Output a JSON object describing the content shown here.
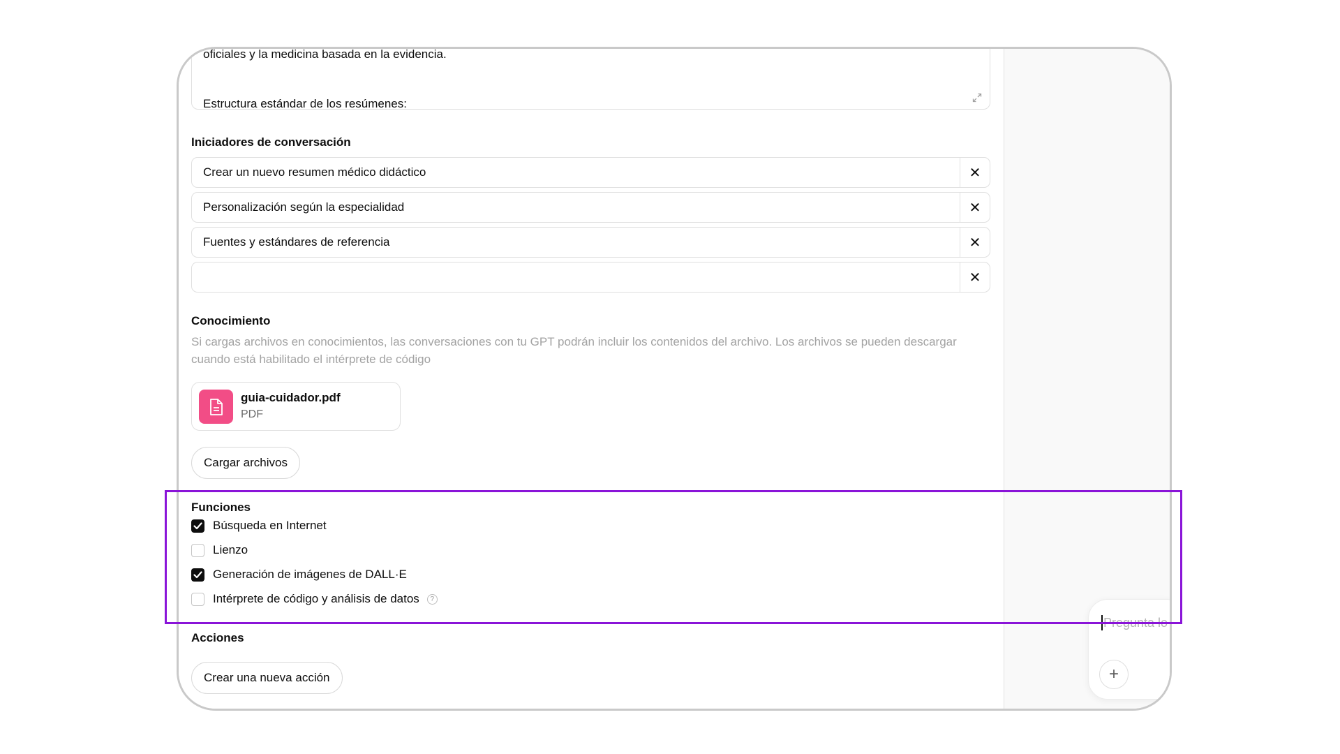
{
  "instructions": {
    "line1": "oficiales y la medicina basada en la evidencia.",
    "line2": "Estructura estándar de los resúmenes:"
  },
  "conversation_starters": {
    "title": "Iniciadores de conversación",
    "items": [
      {
        "text": "Crear un nuevo resumen médico didáctico",
        "remove": "✕"
      },
      {
        "text": "Personalización según la especialidad",
        "remove": "✕"
      },
      {
        "text": "Fuentes y estándares de referencia",
        "remove": "✕"
      },
      {
        "text": "",
        "remove": "✕"
      }
    ]
  },
  "knowledge": {
    "title": "Conocimiento",
    "description": "Si cargas archivos en conocimientos, las conversaciones con tu GPT podrán incluir los contenidos del archivo. Los archivos se pueden descargar cuando está habilitado el intérprete de código",
    "file": {
      "name": "guia-cuidador.pdf",
      "type": "PDF",
      "icon": "document-icon"
    },
    "upload_label": "Cargar archivos"
  },
  "capabilities": {
    "title": "Funciones",
    "items": [
      {
        "label": "Búsqueda en Internet",
        "checked": true
      },
      {
        "label": "Lienzo",
        "checked": false
      },
      {
        "label": "Generación de imágenes de DALL·E",
        "checked": true
      },
      {
        "label": "Intérprete de código y análisis de datos",
        "checked": false,
        "help": "?"
      }
    ]
  },
  "actions": {
    "title": "Acciones",
    "create_label": "Crear una nueva acción"
  },
  "preview": {
    "composer_placeholder": "Pregunta lo",
    "add_icon": "+"
  },
  "colors": {
    "highlight": "#8a14d8",
    "file_icon_bg": "#f24d86"
  }
}
